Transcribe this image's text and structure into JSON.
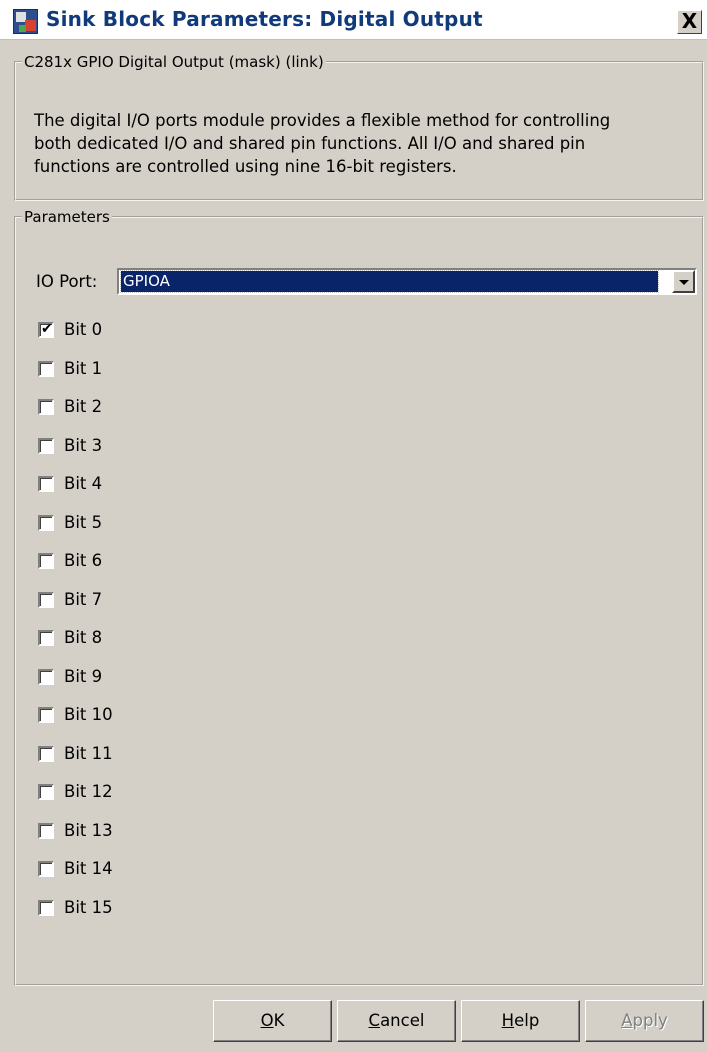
{
  "window": {
    "title": "Sink Block Parameters: Digital Output",
    "close_label": "X"
  },
  "mask_group": {
    "legend": "C281x GPIO Digital Output (mask) (link)",
    "description_lines": [
      "The digital I/O ports module provides a flexible method for controlling",
      "both dedicated I/O and shared pin functions. All I/O and shared pin",
      "functions are controlled using nine 16-bit registers."
    ]
  },
  "parameters": {
    "legend": "Parameters",
    "io_port_label": "IO Port:",
    "io_port_value": "GPIOA",
    "bits": [
      {
        "label": "Bit 0",
        "checked": true
      },
      {
        "label": "Bit 1",
        "checked": false
      },
      {
        "label": "Bit 2",
        "checked": false
      },
      {
        "label": "Bit 3",
        "checked": false
      },
      {
        "label": "Bit 4",
        "checked": false
      },
      {
        "label": "Bit 5",
        "checked": false
      },
      {
        "label": "Bit 6",
        "checked": false
      },
      {
        "label": "Bit 7",
        "checked": false
      },
      {
        "label": "Bit 8",
        "checked": false
      },
      {
        "label": "Bit 9",
        "checked": false
      },
      {
        "label": "Bit 10",
        "checked": false
      },
      {
        "label": "Bit 11",
        "checked": false
      },
      {
        "label": "Bit 12",
        "checked": false
      },
      {
        "label": "Bit 13",
        "checked": false
      },
      {
        "label": "Bit 14",
        "checked": false
      },
      {
        "label": "Bit 15",
        "checked": false
      }
    ]
  },
  "buttons": {
    "ok": {
      "mnemonic": "O",
      "rest": "K"
    },
    "cancel": {
      "mnemonic": "C",
      "rest": "ancel"
    },
    "help": {
      "mnemonic": "H",
      "rest": "elp"
    },
    "apply": {
      "mnemonic": "A",
      "rest": "pply",
      "enabled": false
    }
  },
  "colors": {
    "title_text": "#103a7a",
    "selection_bg": "#0a246a",
    "dialog_bg": "#d4d0c8"
  }
}
